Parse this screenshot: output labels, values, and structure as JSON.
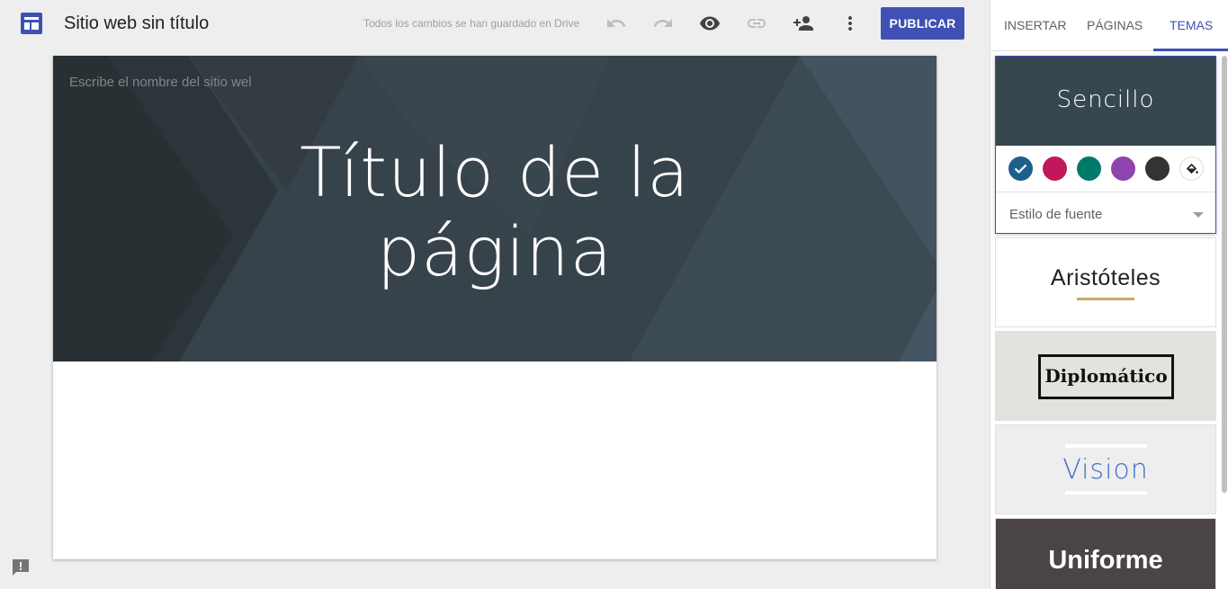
{
  "app": {
    "logo_icon": "google-sites-logo-icon",
    "site_title": "Sitio web sin título",
    "save_status": "Todos los cambios se han guardado en Drive",
    "toolbar": {
      "undo_icon": "undo-icon",
      "redo_icon": "redo-icon",
      "preview_icon": "eye-icon",
      "link_icon": "link-icon",
      "share_icon": "add-person-icon",
      "more_icon": "more-vert-icon",
      "publish_label": "PUBLICAR"
    },
    "accent_color": "#3f51b5"
  },
  "canvas": {
    "site_name_placeholder": "Escribe el nombre del sitio wel",
    "page_title_line1": "Título de la",
    "page_title_line2": "página",
    "header_color": "#37434b"
  },
  "feedback_icon": "feedback-icon",
  "panel": {
    "tabs": [
      {
        "label": "INSERTAR",
        "active": false
      },
      {
        "label": "PÁGINAS",
        "active": false
      },
      {
        "label": "TEMAS",
        "active": true
      }
    ],
    "themes": [
      {
        "name": "Sencillo",
        "selected": true,
        "swatches": [
          {
            "color": "#1f5f8b",
            "selected": true
          },
          {
            "color": "#c2185b",
            "selected": false
          },
          {
            "color": "#00796b",
            "selected": false
          },
          {
            "color": "#8e44ad",
            "selected": false
          },
          {
            "color": "#333333",
            "selected": false
          },
          {
            "color": "#ffffff",
            "icon": "paint-bucket-icon",
            "selected": false
          }
        ],
        "font_style_label": "Estilo de fuente"
      },
      {
        "name": "Aristóteles"
      },
      {
        "name": "Diplomático"
      },
      {
        "name": "Vision"
      },
      {
        "name": "Uniforme"
      }
    ]
  }
}
